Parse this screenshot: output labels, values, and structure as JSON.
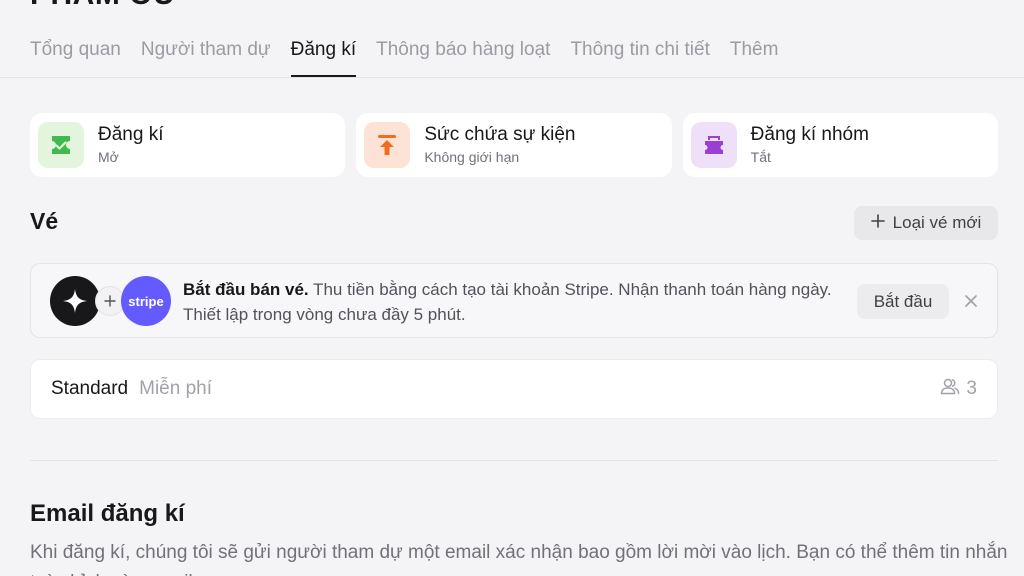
{
  "header": {
    "title": "PHẦM OU"
  },
  "tabs": [
    {
      "label": "Tổng quan",
      "active": false
    },
    {
      "label": "Người tham dự",
      "active": false
    },
    {
      "label": "Đăng kí",
      "active": true
    },
    {
      "label": "Thông báo hàng loạt",
      "active": false
    },
    {
      "label": "Thông tin chi tiết",
      "active": false
    },
    {
      "label": "Thêm",
      "active": false
    }
  ],
  "cards": [
    {
      "title": "Đăng kí",
      "subtitle": "Mở",
      "icon": "ticket-check-icon",
      "icon_bg": "#e3f5dc",
      "icon_color": "#3fb950"
    },
    {
      "title": "Sức chứa sự kiện",
      "subtitle": "Không giới hạn",
      "icon": "arrow-up-limit-icon",
      "icon_bg": "#fde3d6",
      "icon_color": "#f26b21"
    },
    {
      "title": "Đăng kí nhóm",
      "subtitle": "Tắt",
      "icon": "group-ticket-icon",
      "icon_bg": "#efe0fa",
      "icon_color": "#9b3fd4"
    }
  ],
  "tickets": {
    "title": "Vé",
    "new_button": "Loại vé mới",
    "banner": {
      "bold": "Bắt đầu bán vé.",
      "text": " Thu tiền bằng cách tạo tài khoản Stripe. Nhận thanh toán hàng ngày. Thiết lập trong vòng chưa đầy 5 phút.",
      "stripe_label": "stripe",
      "start_button": "Bắt đầu"
    },
    "rows": [
      {
        "name": "Standard",
        "price": "Miễn phí",
        "count": "3"
      }
    ]
  },
  "email": {
    "title": "Email đăng kí",
    "description": "Khi đăng kí, chúng tôi sẽ gửi người tham dự một email xác nhận bao gồm lời mời vào lịch. Bạn có thể thêm tin nhắn tuỳ chỉnh vào email."
  },
  "colors": {
    "accent_stripe": "#635bff",
    "text_primary": "#18181b",
    "text_muted": "#71717a"
  }
}
